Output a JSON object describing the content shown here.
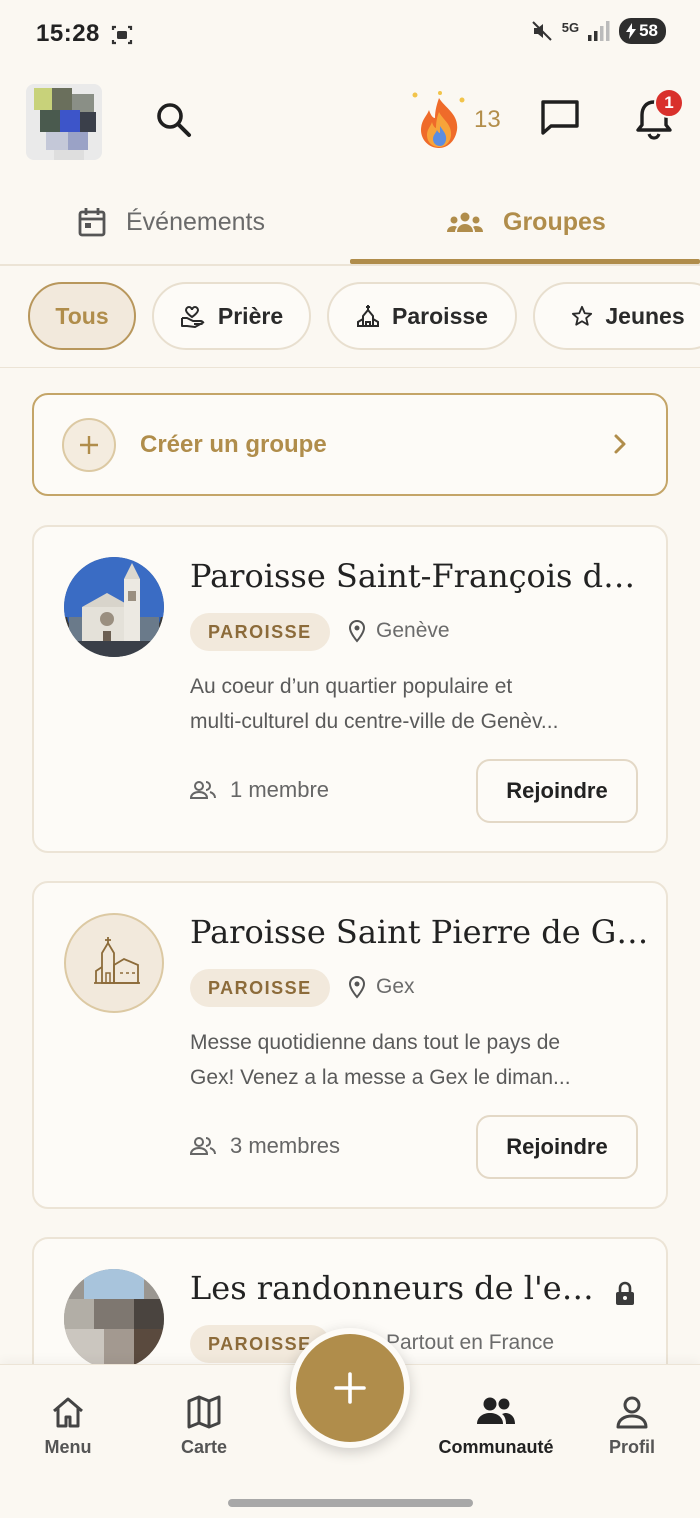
{
  "status_bar": {
    "time": "15:28",
    "network": "5G",
    "battery": "58"
  },
  "header": {
    "streak_count": "13",
    "notification_count": "1"
  },
  "tabs": [
    {
      "label": "Événements",
      "active": false
    },
    {
      "label": "Groupes",
      "active": true
    }
  ],
  "filters": [
    {
      "label": "Tous",
      "active": true
    },
    {
      "label": "Prière",
      "active": false
    },
    {
      "label": "Paroisse",
      "active": false
    },
    {
      "label": "Jeunes",
      "active": false
    }
  ],
  "create_group": {
    "label": "Créer un groupe"
  },
  "groups": [
    {
      "title": "Paroisse Saint-François de S...",
      "category": "PAROISSE",
      "location": "Genève",
      "description_line1": "Au coeur d’un quartier populaire et",
      "description_line2": "multi-culturel du centre-ville de Genèv...",
      "members": "1 membre",
      "join_label": "Rejoindre"
    },
    {
      "title": "Paroisse Saint Pierre de Gex",
      "category": "PAROISSE",
      "location": "Gex",
      "description_line1": "Messe quotidienne dans tout le pays de",
      "description_line2": "Gex! Venez a la messe a Gex le diman...",
      "members": "3 membres",
      "join_label": "Rejoindre"
    },
    {
      "title": "Les randonneurs de l'extr...",
      "category": "PAROISSE",
      "location": "Partout en France",
      "private": true
    }
  ],
  "bottom_nav": [
    {
      "label": "Menu",
      "icon": "home-icon",
      "active": false
    },
    {
      "label": "Carte",
      "icon": "map-icon",
      "active": false
    },
    {
      "label": "Communauté",
      "icon": "community-icon",
      "active": true
    },
    {
      "label": "Profil",
      "icon": "profile-icon",
      "active": false
    }
  ],
  "colors": {
    "accent": "#b08d4b",
    "background": "#fbf8f2",
    "badge": "#d9312c"
  }
}
